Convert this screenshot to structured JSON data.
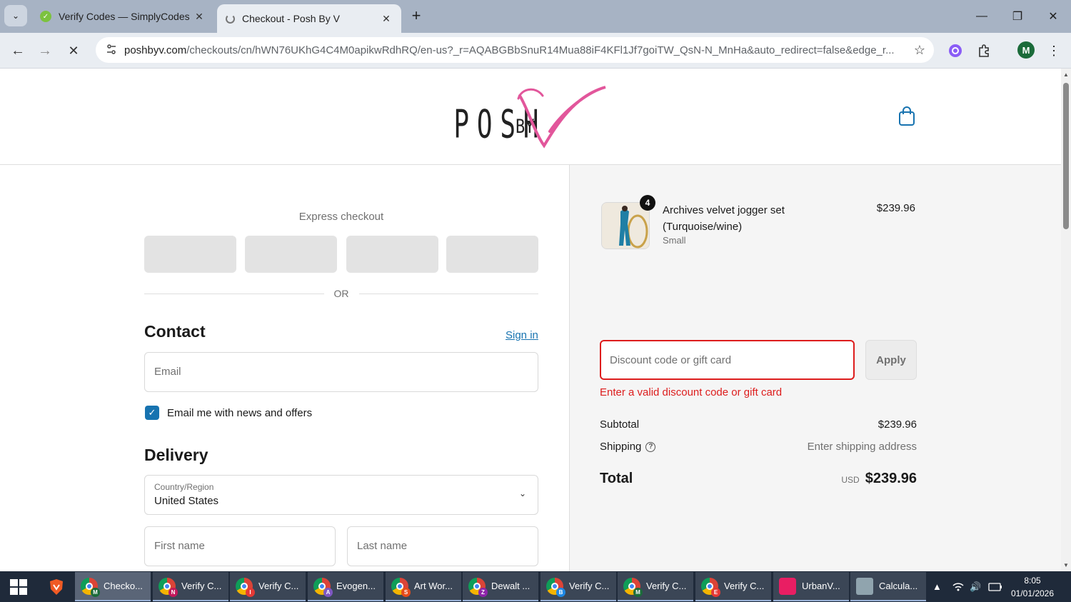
{
  "browser": {
    "tabs": [
      {
        "title": "Verify Codes — SimplyCodes",
        "active": false
      },
      {
        "title": "Checkout - Posh By V",
        "active": true
      }
    ],
    "url_host": "poshbyv.com",
    "url_path": "/checkouts/cn/hWN76UKhG4C4M0apikwRdhRQ/en-us?_r=AQABGBbSnuR14Mua88iF4KFl1Jf7goiTW_QsN-N_MnHa&auto_redirect=false&edge_r...",
    "profile_initial": "M"
  },
  "header": {
    "logo_text_posh": "POSH",
    "logo_text_by": "BY",
    "logo_text_v": "V"
  },
  "checkout": {
    "express_title": "Express checkout",
    "or_label": "OR",
    "contact_heading": "Contact",
    "sign_in_link": "Sign in",
    "email_placeholder": "Email",
    "newsletter_label": "Email me with news and offers",
    "delivery_heading": "Delivery",
    "country_label": "Country/Region",
    "country_value": "United States",
    "first_name_placeholder": "First name",
    "last_name_placeholder": "Last name"
  },
  "summary": {
    "product_name": "Archives velvet jogger set (Turquoise/wine)",
    "product_variant": "Small",
    "product_qty": "4",
    "product_price": "$239.96",
    "discount_placeholder": "Discount code or gift card",
    "apply_label": "Apply",
    "discount_error": "Enter a valid discount code or gift card",
    "subtotal_label": "Subtotal",
    "subtotal_value": "$239.96",
    "shipping_label": "Shipping",
    "shipping_value": "Enter shipping address",
    "total_label": "Total",
    "total_currency": "USD",
    "total_value": "$239.96"
  },
  "taskbar": {
    "items": [
      {
        "label": "Checko...",
        "badge": "M",
        "badge_color": "#1b6b3a"
      },
      {
        "label": "Verify C...",
        "badge": "N",
        "badge_color": "#c2185b"
      },
      {
        "label": "Verify C...",
        "badge": "I",
        "badge_color": "#e53935"
      },
      {
        "label": "Evogen...",
        "badge": "A",
        "badge_color": "#7e57c2"
      },
      {
        "label": "Art Wor...",
        "badge": "S",
        "badge_color": "#e64a19"
      },
      {
        "label": "Dewalt ...",
        "badge": "Z",
        "badge_color": "#8e24aa"
      },
      {
        "label": "Verify C...",
        "badge": "B",
        "badge_color": "#1e88e5"
      },
      {
        "label": "Verify C...",
        "badge": "M",
        "badge_color": "#1b6b3a"
      },
      {
        "label": "Verify C...",
        "badge": "E",
        "badge_color": "#e53935"
      },
      {
        "label": "UrbanV...",
        "badge": "",
        "badge_color": "#e91e63"
      },
      {
        "label": "Calcula...",
        "badge": "",
        "badge_color": "#90a4ae"
      }
    ],
    "time": "8:05",
    "date": "01/01/2026"
  },
  "colors": {
    "accent_blue": "#1773b0",
    "error_red": "#dd1d1d",
    "logo_pink": "#e2569b"
  }
}
